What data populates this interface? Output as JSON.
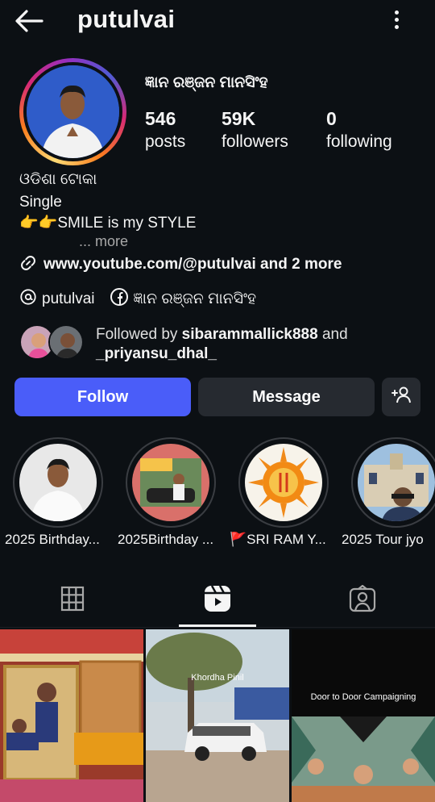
{
  "header": {
    "username": "putulvai"
  },
  "profile": {
    "full_name": "ଜ୍ଞାନ ରଞ୍ଜନ ମାନସିଂହ",
    "stats": [
      {
        "value": "546",
        "label": "posts"
      },
      {
        "value": "59K",
        "label": "followers"
      },
      {
        "value": "0",
        "label": "following"
      }
    ],
    "bio": [
      "ଓଡିଶା ଟୋକା",
      "Single",
      "👉👉SMILE is my STYLE"
    ],
    "more_label": "... more",
    "link_text": "www.youtube.com/@putulvai and 2 more",
    "threads_handle": "putulvai",
    "facebook_name": "ଜ୍ଞାନ ରଞ୍ଜନ ମାନସିଂହ",
    "followed_by_prefix": "Followed by ",
    "followed_by_user1": "sibarammallick888",
    "followed_by_and": " and",
    "followed_by_user2": "_priyansu_dhal_"
  },
  "actions": {
    "follow_label": "Follow",
    "message_label": "Message"
  },
  "highlights": [
    {
      "label": "2025 Birthday..."
    },
    {
      "label": "2025Birthday ..."
    },
    {
      "label": "🚩SRI RAM Y..."
    },
    {
      "label": "2025 Tour jyo"
    }
  ],
  "tabs": [
    {
      "icon": "grid-icon"
    },
    {
      "icon": "reels-icon",
      "active": true
    },
    {
      "icon": "tagged-icon"
    }
  ],
  "posts": [
    {
      "caption": ""
    },
    {
      "caption": "Khordha Pinil"
    },
    {
      "caption": "Door to Door Campaigning"
    }
  ],
  "colors": {
    "background": "#0c1014",
    "follow_button": "#4a5df9",
    "secondary_button": "#262a30",
    "muted_text": "#a8a8a8"
  }
}
